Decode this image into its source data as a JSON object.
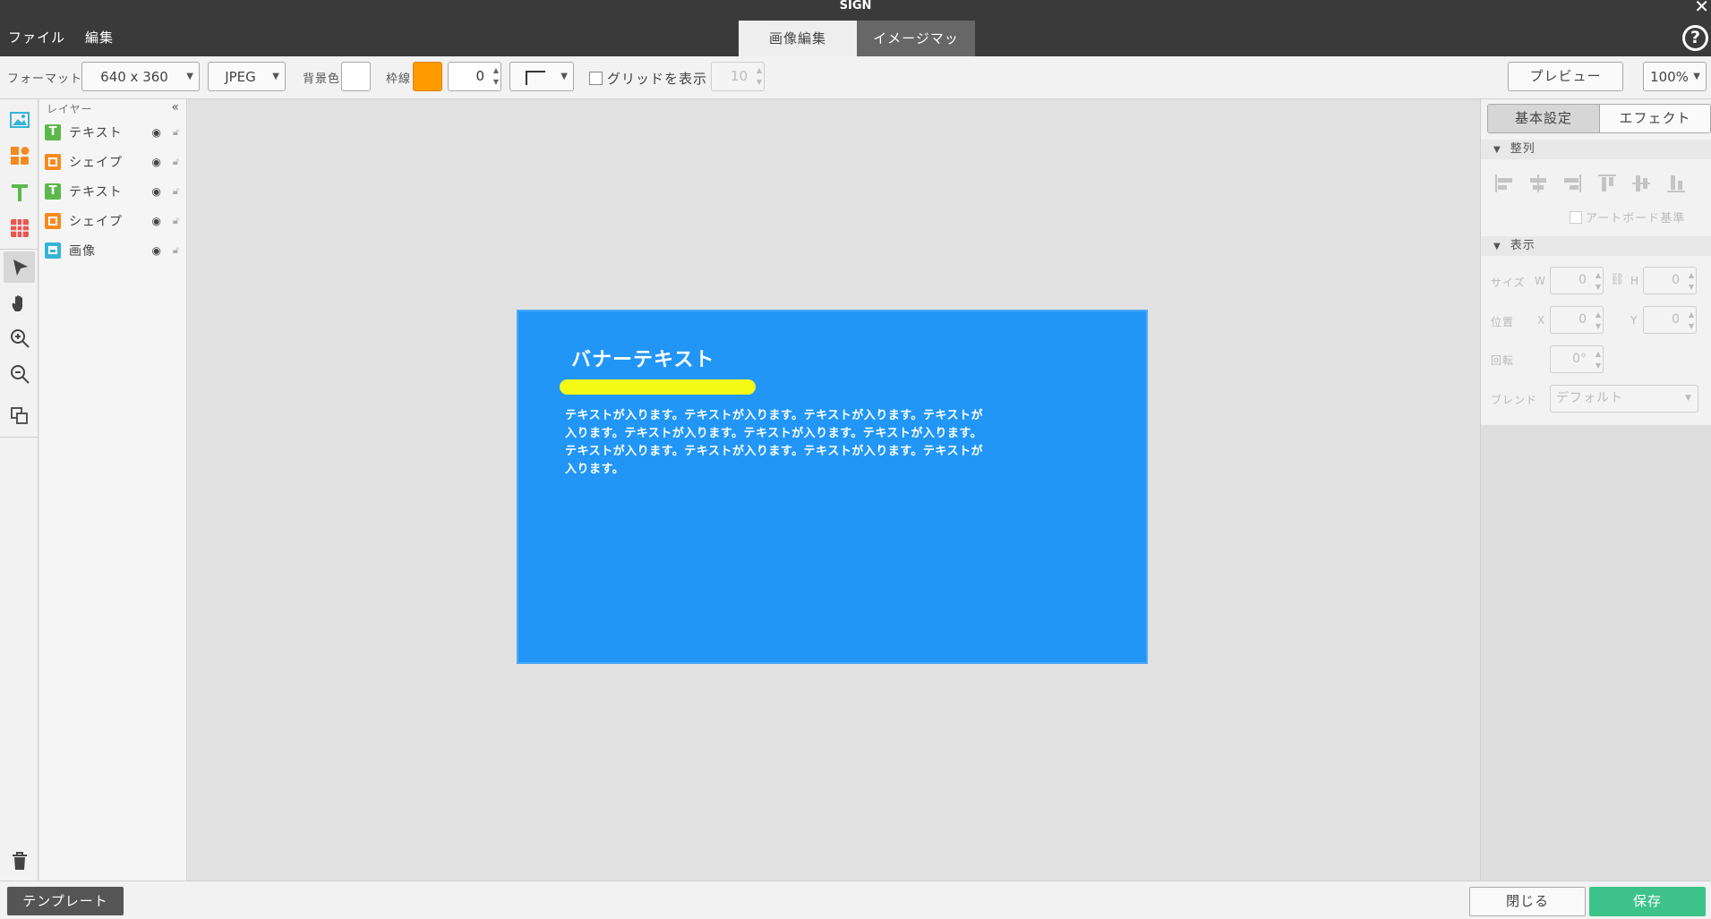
{
  "app": {
    "title": "SIGN",
    "close_glyph": "✕",
    "help_glyph": "?"
  },
  "menu": {
    "file": "ファイル",
    "edit": "編集"
  },
  "tabs": [
    {
      "label": "画像編集",
      "active": true
    },
    {
      "label": "イメージマップ",
      "active": false
    }
  ],
  "toolbar": {
    "format_label": "フォーマット",
    "format_value": "640 x 360",
    "type_value": "JPEG",
    "bg_label": "背景色",
    "bg_color": "#ffffff",
    "border_label": "枠線",
    "border_color": "#ff9a00",
    "border_width": "0",
    "grid_label": "グリッドを表示",
    "grid_checked": false,
    "grid_size": "10",
    "preview_label": "プレビュー",
    "zoom_value": "100%"
  },
  "tools": [
    "image-icon",
    "shape-icon",
    "text-icon",
    "table-icon",
    "select-arrow-icon",
    "hand-icon",
    "zoom-in-icon",
    "zoom-out-icon",
    "arrange-icon",
    "trash-icon"
  ],
  "layers": {
    "header": "レイヤー",
    "collapse_glyph": "«",
    "items": [
      {
        "name": "テキスト",
        "type": "text",
        "color": "#5cb84c",
        "glyph": "T"
      },
      {
        "name": "シェイプ",
        "type": "shape",
        "color": "#f58a1f",
        "glyph": "■"
      },
      {
        "name": "テキスト",
        "type": "text",
        "color": "#5cb84c",
        "glyph": "T"
      },
      {
        "name": "シェイプ",
        "type": "shape",
        "color": "#f58a1f",
        "glyph": "■"
      },
      {
        "name": "画像",
        "type": "image",
        "color": "#36b4d6",
        "glyph": "▣"
      }
    ]
  },
  "canvas": {
    "banner_color": "#2196f6",
    "title": "バナーテキスト",
    "bar_color": "#f4fa16",
    "body_lines": [
      "テキストが入ります。テキストが入ります。テキストが入ります。テキストが",
      "入ります。テキストが入ります。テキストが入ります。テキストが入ります。",
      "テキストが入ります。テキストが入ります。テキストが入ります。テキストが",
      "入ります。"
    ]
  },
  "properties": {
    "tabs": {
      "basic": "基本設定",
      "effect": "エフェクト"
    },
    "align_section": "整列",
    "artboard_label": "アートボード基準",
    "display_section": "表示",
    "size_label": "サイズ",
    "w_label": "W",
    "w_value": "0",
    "h_label": "H",
    "h_value": "0",
    "position_label": "位置",
    "x_label": "X",
    "x_value": "0",
    "y_label": "Y",
    "y_value": "0",
    "rotate_label": "回転",
    "rotate_value": "0°",
    "blend_label": "ブレンド",
    "blend_value": "デフォルト"
  },
  "bottom": {
    "template": "テンプレート",
    "close": "閉じる",
    "save": "保存"
  }
}
